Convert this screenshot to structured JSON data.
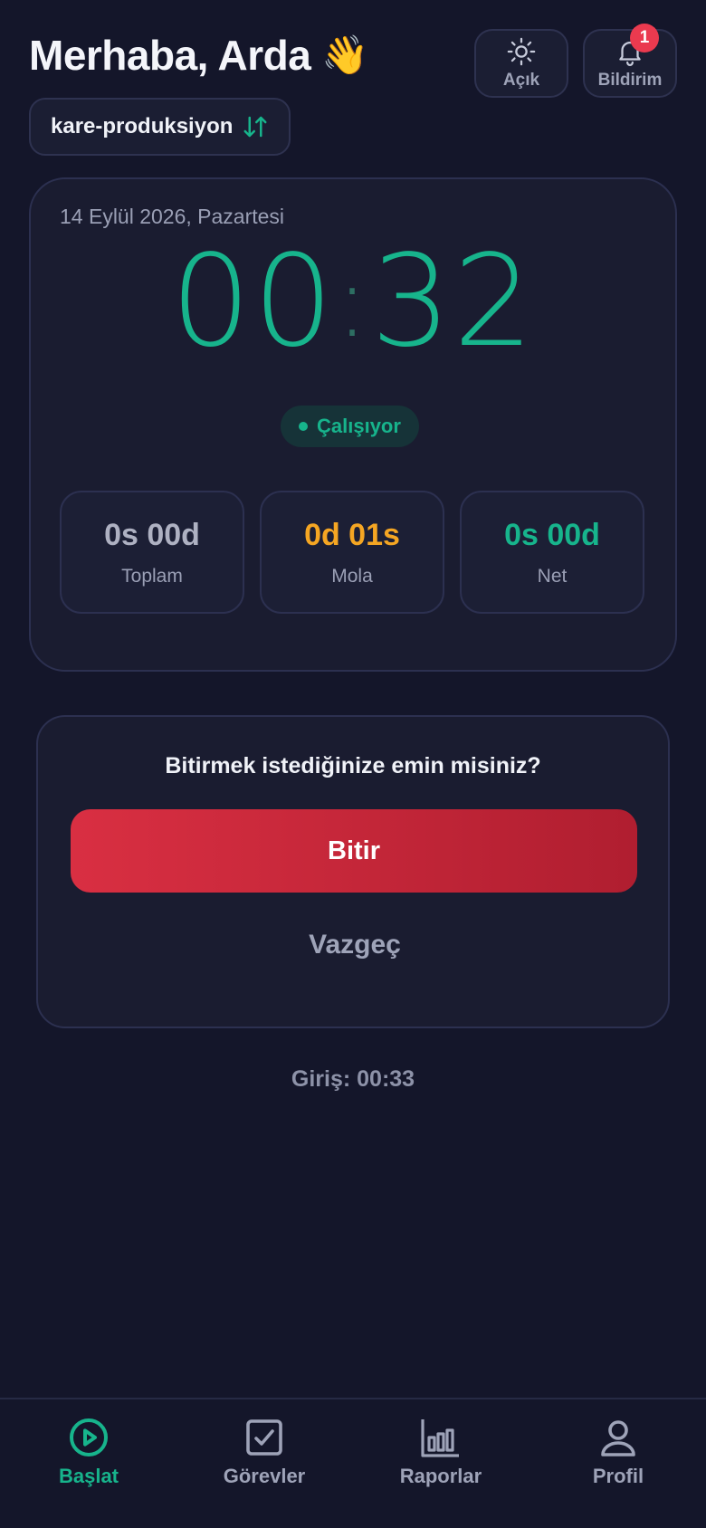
{
  "header": {
    "greeting": "Merhaba, Arda",
    "wave_emoji": "👋",
    "theme_button_label": "Açık",
    "notification_button_label": "Bildirim",
    "notification_count": "1",
    "workspace_name": "kare-produksiyon"
  },
  "timer": {
    "date": "14 Eylül 2026, Pazartesi",
    "hours": "00",
    "separator": ":",
    "minutes": "32",
    "status": "Çalışıyor",
    "stats": [
      {
        "value": "0s 00d",
        "label": "Toplam",
        "color": "#aeb1c2"
      },
      {
        "value": "0d 01s",
        "label": "Mola",
        "color": "#f5a623"
      },
      {
        "value": "0s 00d",
        "label": "Net",
        "color": "#17b48c"
      }
    ]
  },
  "confirm": {
    "question": "Bitirmek istediğinize emin misiniz?",
    "finish_label": "Bitir",
    "cancel_label": "Vazgeç"
  },
  "login_time": "Giriş: 00:33",
  "nav": {
    "items": [
      {
        "label": "Başlat",
        "icon": "play-circle-icon",
        "active": true
      },
      {
        "label": "Görevler",
        "icon": "checkbox-icon",
        "active": false
      },
      {
        "label": "Raporlar",
        "icon": "bar-chart-icon",
        "active": false
      },
      {
        "label": "Profil",
        "icon": "user-icon",
        "active": false
      }
    ]
  },
  "colors": {
    "accent": "#17b48c",
    "break": "#f5a623",
    "danger": "#d92f42",
    "background": "#14162a"
  }
}
